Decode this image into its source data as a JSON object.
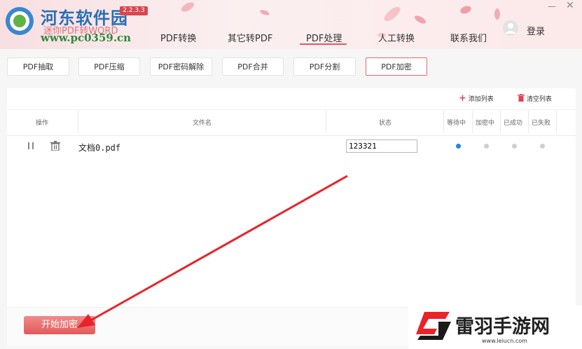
{
  "app": {
    "logo_title": "河东软件园",
    "logo_subtitle": "迷你PDF转WORD",
    "logo_url": "www.pc0359.cn",
    "version": "2.2.3.3"
  },
  "nav": {
    "items": [
      "PDF转换",
      "其它转PDF",
      "PDF处理",
      "人工转换",
      "联系我们"
    ],
    "active": "PDF处理",
    "login": "登录"
  },
  "tools": {
    "items": [
      "PDF抽取",
      "PDF压缩",
      "PDF密码解除",
      "PDF合并",
      "PDF分割",
      "PDF加密"
    ],
    "active": "PDF加密"
  },
  "list_actions": {
    "add": "添加列表",
    "clear": "清空列表"
  },
  "table": {
    "headers": {
      "op": "操作",
      "name": "文件名",
      "status": "状态",
      "waiting": "等待中",
      "encrypting": "加密中",
      "success": "已成功",
      "failed": "已失败"
    },
    "rows": [
      {
        "name": "文档0.pdf",
        "password": "123321",
        "stage": "waiting"
      }
    ]
  },
  "start_button": "开始加密",
  "watermark": {
    "text": "雷羽手游网",
    "url": "www.leiucn.com"
  },
  "colors": {
    "accent": "#e05a63",
    "dot_active": "#1e88e5",
    "dot_idle": "#cfcfcf",
    "arrow": "#e8232a"
  }
}
